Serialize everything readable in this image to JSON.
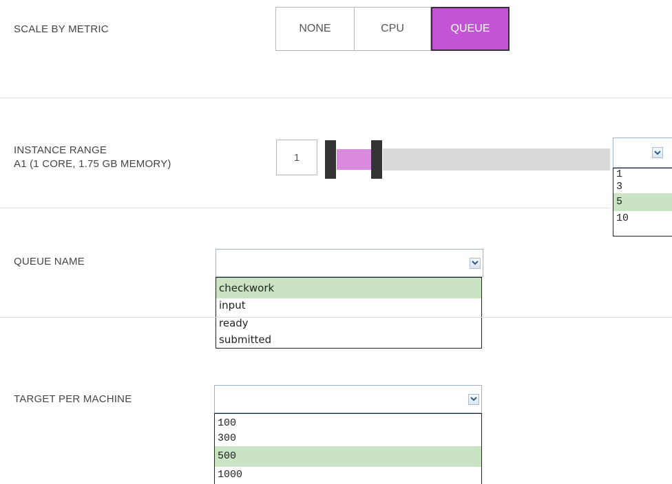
{
  "scale_by_metric": {
    "label": "SCALE BY METRIC",
    "options": [
      {
        "label": "NONE",
        "active": false
      },
      {
        "label": "CPU",
        "active": false
      },
      {
        "label": "QUEUE",
        "active": true
      }
    ]
  },
  "instance_range": {
    "label_line1": "INSTANCE RANGE",
    "label_line2": "A1 (1 CORE, 1.75 GB MEMORY)",
    "min_value": "1",
    "max_dropdown": {
      "selected": "",
      "options": [
        "1",
        "3",
        "5",
        "10"
      ],
      "highlighted": "5"
    }
  },
  "queue_name": {
    "label": "QUEUE NAME",
    "dropdown": {
      "selected": "",
      "options": [
        "checkwork",
        "input",
        "ready",
        "submitted"
      ],
      "highlighted": "checkwork"
    }
  },
  "target_per_machine": {
    "label": "TARGET PER MACHINE",
    "dropdown": {
      "selected": "",
      "options": [
        "100",
        "300",
        "500",
        "1000"
      ],
      "highlighted": "500"
    }
  },
  "colors": {
    "accent": "#c354d6",
    "range_fill": "#d98ade",
    "highlight": "#c9e3c3",
    "track": "#d9d9d9"
  },
  "icons": {
    "dropdown_arrow": "chevron-down-icon"
  }
}
